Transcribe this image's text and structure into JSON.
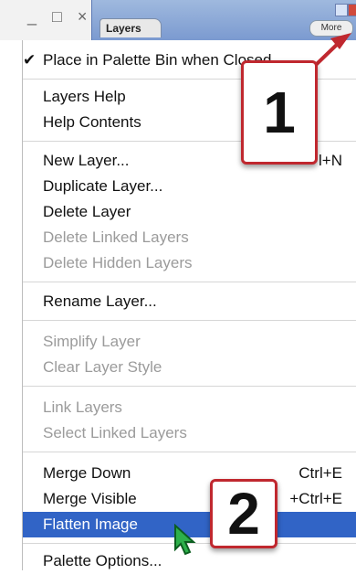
{
  "window": {
    "controls": "_ □ ×",
    "tab_label": "Layers",
    "more_label": "More"
  },
  "menu": {
    "items": [
      {
        "label": "Place in Palette Bin when Closed",
        "checked": true
      },
      {
        "label": "Layers Help"
      },
      {
        "label": "Help Contents"
      },
      {
        "label": "New Layer...",
        "shortcut": "l+N"
      },
      {
        "label": "Duplicate Layer..."
      },
      {
        "label": "Delete Layer"
      },
      {
        "label": "Delete Linked Layers",
        "disabled": true
      },
      {
        "label": "Delete Hidden Layers",
        "disabled": true
      },
      {
        "label": "Rename Layer..."
      },
      {
        "label": "Simplify Layer",
        "disabled": true
      },
      {
        "label": "Clear Layer Style",
        "disabled": true
      },
      {
        "label": "Link Layers",
        "disabled": true
      },
      {
        "label": "Select Linked Layers",
        "disabled": true
      },
      {
        "label": "Merge Down",
        "shortcut": "Ctrl+E"
      },
      {
        "label": "Merge Visible",
        "shortcut": "+Ctrl+E"
      },
      {
        "label": "Flatten Image",
        "highlighted": true
      },
      {
        "label": "Palette Options..."
      }
    ]
  },
  "callouts": {
    "one": "1",
    "two": "2"
  },
  "colors": {
    "highlight": "#3164c6",
    "callout_border": "#c0282f",
    "disabled_text": "#9b9b9b"
  }
}
